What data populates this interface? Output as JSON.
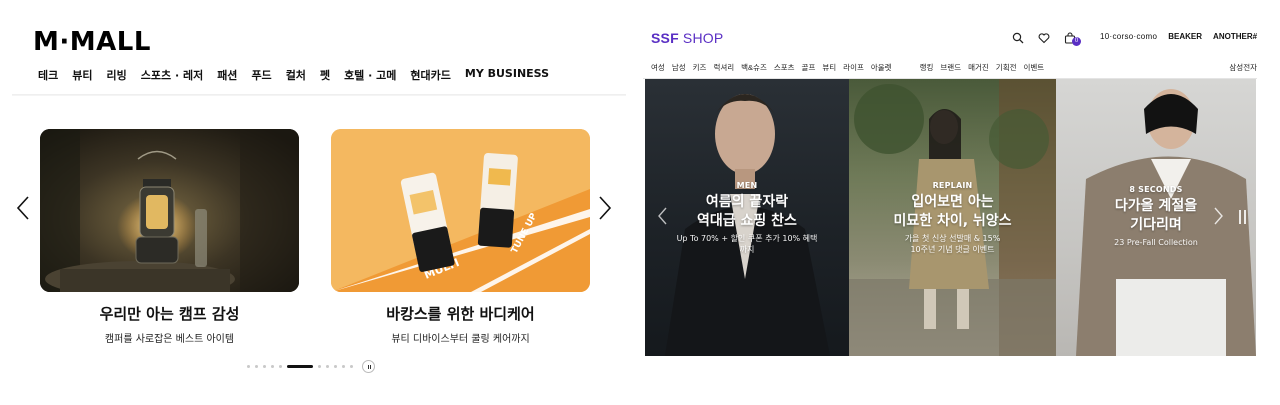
{
  "mmall": {
    "logo": "M·MALL",
    "nav": [
      "테크",
      "뷰티",
      "리빙",
      "스포츠 · 레저",
      "패션",
      "푸드",
      "컬처",
      "펫",
      "호텔 · 고메",
      "현대카드",
      "MY BUSINESS"
    ],
    "cards": [
      {
        "title": "우리만 아는 캠프 감성",
        "subtitle": "캠퍼를 사로잡은 베스트 아이템"
      },
      {
        "title": "바캉스를 위한 바디케어",
        "subtitle": "뷰티 디바이스부터 쿨링 케어까지",
        "product_text": [
          "MULTI",
          "TUNE UP"
        ]
      }
    ],
    "pagination": {
      "total": 12,
      "active_index": 5
    }
  },
  "ssf": {
    "logo_bold": "SSF",
    "logo_rest": " SHOP",
    "cart_count": "0",
    "brands": [
      "10·corso·como",
      "BEAKER",
      "ANOTHER#"
    ],
    "nav_left": [
      "여성",
      "남성",
      "키즈",
      "럭셔리",
      "백&슈즈",
      "스포츠",
      "골프",
      "뷰티",
      "라이프",
      "아울렛"
    ],
    "nav_mid": [
      "랭킹",
      "브랜드",
      "매거진",
      "기획전",
      "이벤트"
    ],
    "nav_right": "삼성전자",
    "panels": [
      {
        "tag": "MEN",
        "headline_1": "여름의 끝자락",
        "headline_2": "역대급 쇼핑 찬스",
        "sub_1": "Up To 70% + 할인 쿠폰 추가 10% 혜택",
        "sub_2": "까지"
      },
      {
        "tag": "REPLAIN",
        "headline_1": "입어보면 아는",
        "headline_2": "미묘한 차이, 뉘앙스",
        "sub_1": "가을 첫 신상 선발매 & 15%",
        "sub_2": "10주년 기념 댓글 이벤트"
      },
      {
        "tag": "8 SECONDS",
        "headline_1": "다가올 계절을",
        "headline_2": "기다리며",
        "sub_1": "23 Pre-Fall Collection",
        "sub_2": ""
      }
    ]
  },
  "colors": {
    "ssf_purple": "#5a2fc4",
    "mmall_black": "#000000"
  }
}
